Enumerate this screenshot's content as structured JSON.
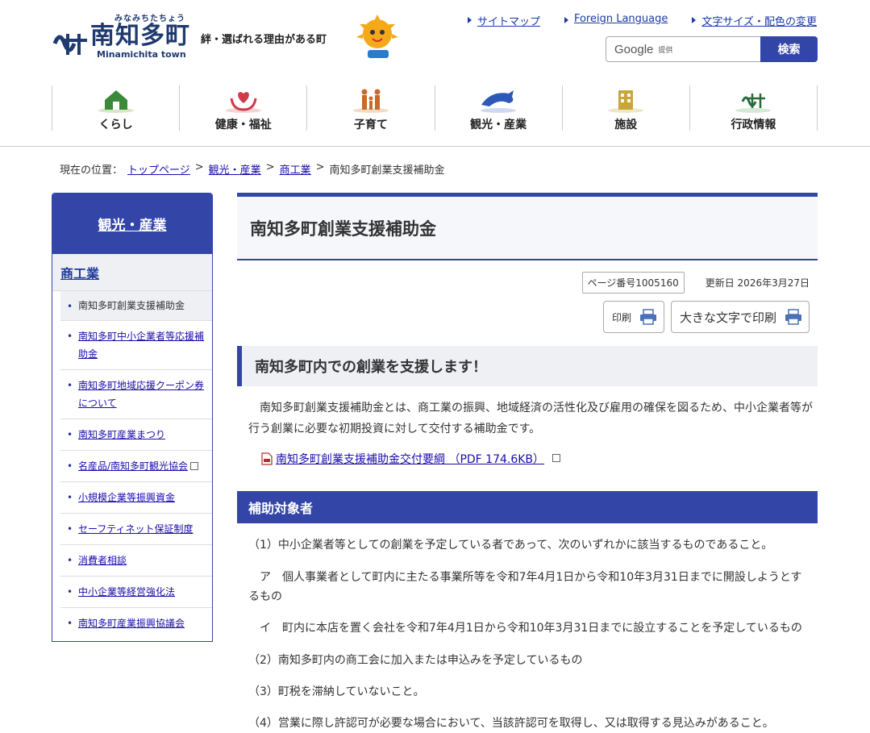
{
  "header": {
    "logo_kana": "みなみちたちょう",
    "logo_name": "南知多町",
    "logo_roman": "Minamichita town",
    "tagline": "絆・選ばれる理由がある町",
    "toplinks": [
      "サイトマップ",
      "Foreign Language",
      "文字サイズ・配色の変更"
    ],
    "search": {
      "google_label": "Google",
      "provided_label": "提供",
      "button": "検索"
    }
  },
  "gnav": [
    {
      "label": "くらし",
      "icon": "house-icon"
    },
    {
      "label": "健康・福祉",
      "icon": "heart-hands-icon"
    },
    {
      "label": "子育て",
      "icon": "family-icon"
    },
    {
      "label": "観光・産業",
      "icon": "dolphin-icon"
    },
    {
      "label": "施設",
      "icon": "building-icon"
    },
    {
      "label": "行政情報",
      "icon": "town-emblem-icon"
    }
  ],
  "breadcrumb": {
    "prefix": "現在の位置：",
    "items": [
      "トップページ",
      "観光・産業",
      "商工業"
    ],
    "current": "南知多町創業支援補助金",
    "sep": ">"
  },
  "sidebar": {
    "heading": "観光・産業",
    "subheading": "商工業",
    "items": [
      {
        "label": "南知多町創業支援補助金",
        "current": true
      },
      {
        "label": "南知多町中小企業者等応援補助金"
      },
      {
        "label": "南知多町地域応援クーポン券について"
      },
      {
        "label": "南知多町産業まつり"
      },
      {
        "label": "名産品/南知多町観光協会",
        "external": true
      },
      {
        "label": "小規模企業等振興資金"
      },
      {
        "label": "セーフティネット保証制度"
      },
      {
        "label": "消費者相談"
      },
      {
        "label": "中小企業等経営強化法"
      },
      {
        "label": "南知多町産業振興協議会"
      }
    ]
  },
  "main": {
    "title": "南知多町創業支援補助金",
    "page_no": "ページ番号1005160",
    "updated": "更新日 2026年3月27日",
    "print_label": "印刷",
    "print_large_label": "大きな文字で印刷",
    "section1_title": "南知多町内での創業を支援します！",
    "section1_text": "南知多町創業支援補助金とは、商工業の振興、地域経済の活性化及び雇用の確保を図るため、中小企業者等が行う創業に必要な初期投資に対して交付する補助金です。",
    "pdf_link": "南知多町創業支援補助金交付要綱 （PDF 174.6KB）",
    "section2_title": "補助対象者",
    "items": [
      "（1）中小企業者等としての創業を予定している者であって、次のいずれかに該当するものであること。",
      "　ア　個人事業者として町内に主たる事業所等を令和7年4月1日から令和10年3月31日までに開設しようとするもの",
      "　イ　町内に本店を置く会社を令和7年4月1日から令和10年3月31日までに設立することを予定しているもの",
      "（2）南知多町内の商工会に加入または申込みを予定しているもの",
      "（3）町税を滞納していないこと。",
      "（4）営業に際し許認可が必要な場合において、当該許認可を取得し、又は取得する見込みがあること。"
    ]
  },
  "colors": {
    "primary": "#3346a8",
    "link": "#1a0dab",
    "panel_bg": "#eef0f4"
  }
}
